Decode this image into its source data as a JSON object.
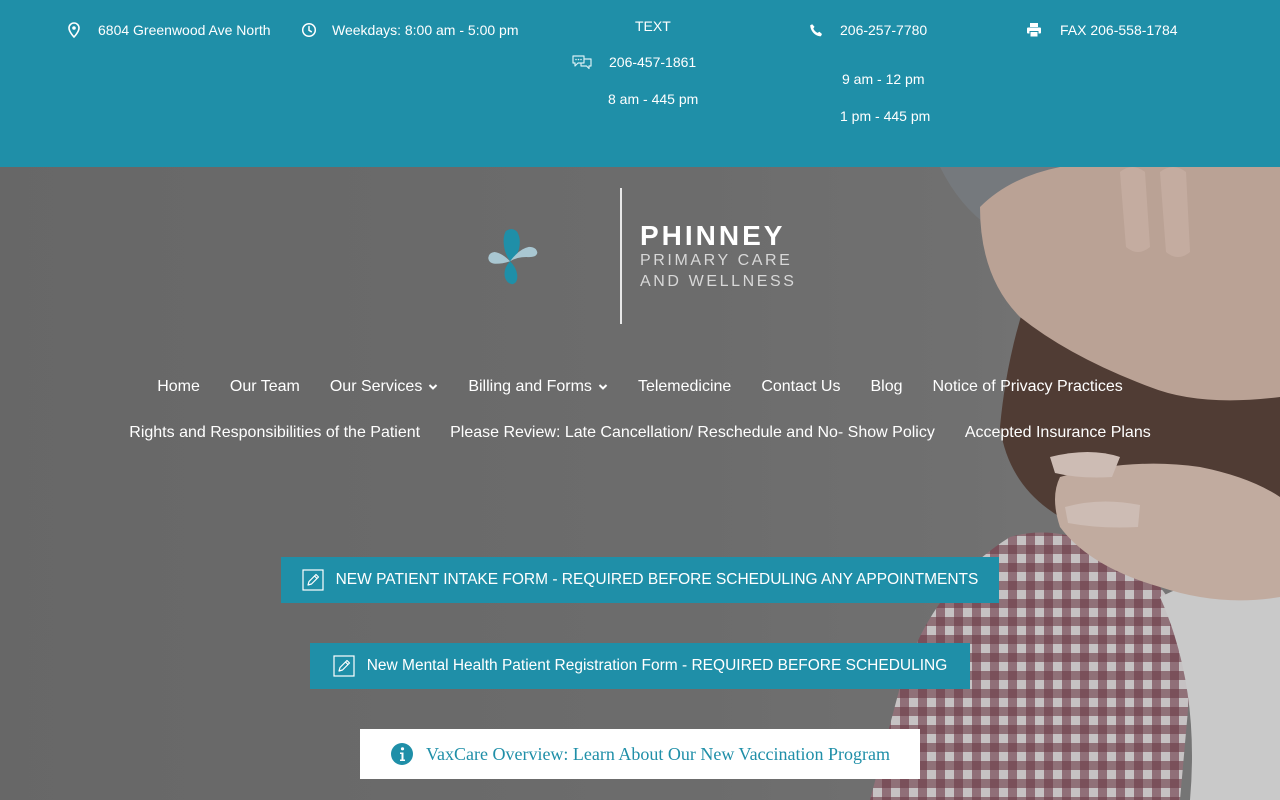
{
  "topbar": {
    "address": "6804 Greenwood Ave North",
    "hours": "Weekdays: 8:00 am - 5:00 pm",
    "text_label": "TEXT",
    "text_number": "206-457-1861",
    "text_hours": "8 am - 445 pm",
    "phone": "206-257-7780",
    "phone_hours_1": "9 am - 12 pm",
    "phone_hours_2": "1 pm - 445 pm",
    "fax": "FAX 206-558-1784"
  },
  "logo": {
    "name": "PHINNEY",
    "line1": "PRIMARY CARE",
    "line2": "AND WELLNESS"
  },
  "nav": {
    "row1": [
      {
        "label": "Home",
        "dropdown": false
      },
      {
        "label": "Our Team",
        "dropdown": false
      },
      {
        "label": "Our Services",
        "dropdown": true
      },
      {
        "label": "Billing and Forms",
        "dropdown": true
      },
      {
        "label": "Telemedicine",
        "dropdown": false
      },
      {
        "label": "Contact Us",
        "dropdown": false
      },
      {
        "label": "Blog",
        "dropdown": false
      },
      {
        "label": "Notice of Privacy Practices",
        "dropdown": false
      }
    ],
    "row2": [
      {
        "label": "Rights and Responsibilities of the Patient",
        "dropdown": false
      },
      {
        "label": "Please Review: Late Cancellation/ Reschedule and No- Show Policy",
        "dropdown": false
      },
      {
        "label": "Accepted Insurance Plans",
        "dropdown": false
      }
    ]
  },
  "buttons": {
    "intake": "NEW PATIENT INTAKE FORM - REQUIRED BEFORE SCHEDULING ANY APPOINTMENTS",
    "mental_health": "New Mental Health Patient Registration Form - REQUIRED BEFORE SCHEDULING",
    "vaxcare": "VaxCare Overview: Learn About Our New Vaccination Program"
  },
  "colors": {
    "brand_teal": "#1f8fa8",
    "logo_light": "#a9c7d2"
  },
  "icons": {
    "address": "map-pin-icon",
    "hours": "clock-icon",
    "text": "chat-bubbles-icon",
    "phone": "phone-icon",
    "fax": "printer-icon",
    "form": "pencil-form-icon",
    "info": "info-icon"
  }
}
